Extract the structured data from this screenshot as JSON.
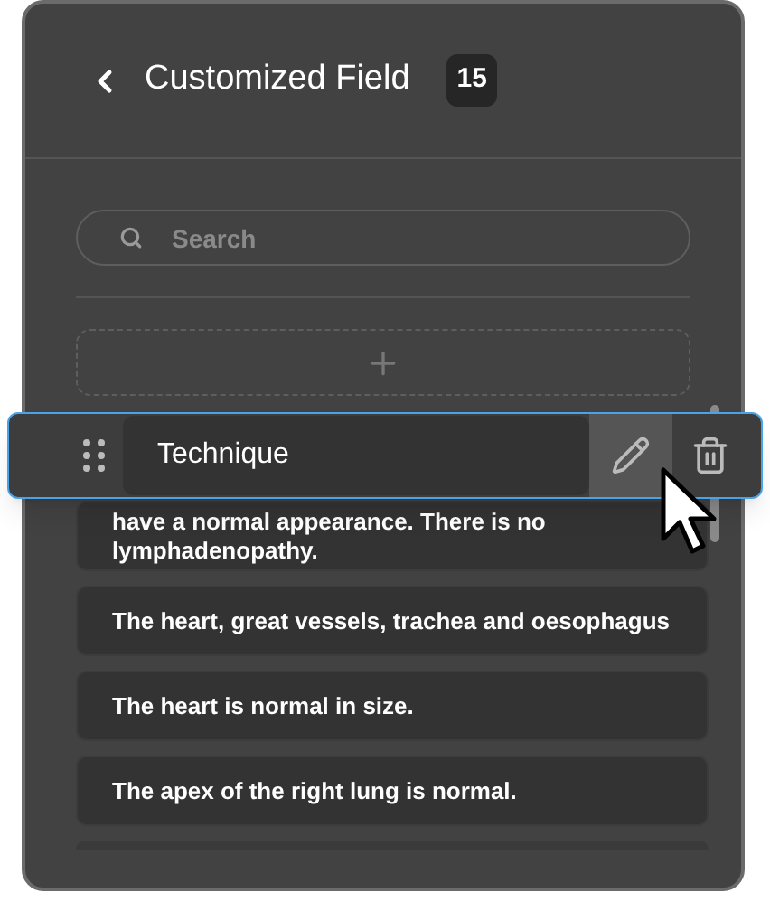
{
  "header": {
    "title": "Customized Field",
    "count": "15"
  },
  "search": {
    "placeholder": "Search"
  },
  "dragged_item": {
    "label": "Technique"
  },
  "items": [
    {
      "text": "have a normal appearance. There is no lymphadenopathy."
    },
    {
      "text": "The heart, great vessels, trachea and oesophagus"
    },
    {
      "text": "The heart is normal in size."
    },
    {
      "text": "The apex of the right lung is normal."
    }
  ]
}
